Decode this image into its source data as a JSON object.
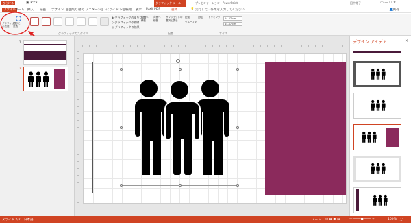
{
  "titlebar": {
    "app_badge": "ひらける",
    "contextual_tab": "グラフィック ツール",
    "window_title": "プレゼンテーション - PowerPoint",
    "user": "田中花子"
  },
  "tabs": [
    "ファイル",
    "ホーム",
    "挿入",
    "描画",
    "デザイン",
    "画面切り替え",
    "アニメーション",
    "スライド ショー",
    "校閲",
    "表示",
    "Foxit PDF",
    "書式"
  ],
  "tell_me": "実行したい作業を入力してください",
  "share": "共有",
  "ribbon": {
    "left_btn1": "グラフィック\nの変更",
    "left_btn2": "図形に\n変換",
    "group_graphics_style": "グラフィックのスタイル",
    "fill_label": "グラフィックの塗りつぶし",
    "outline_label": "グラフィックの枠線",
    "effects_label": "グラフィックの効果",
    "arrange_btns": [
      "前面へ\n移動",
      "背面へ\n移動",
      "オブジェクトの\n選択と表示"
    ],
    "align_label": "配置",
    "group_label": "グループ化",
    "rotate_label": "回転",
    "crop_label": "トリミング",
    "group_arrange": "配置",
    "group_size": "サイズ",
    "height_value": "14.47 cm",
    "width_value": "14.47 cm"
  },
  "thumbnails": [
    {
      "number": "1"
    },
    {
      "number": "2"
    }
  ],
  "design_pane": {
    "title": "デザイン アイデア",
    "close": "×"
  },
  "status": {
    "slide": "スライド 2/2",
    "language": "日本語",
    "notes": "ノート",
    "zoom": "100%"
  },
  "colors": {
    "accent": "#d04423",
    "slide_bar": "#8b2a5c",
    "dark_bar": "#4a1a3a"
  }
}
